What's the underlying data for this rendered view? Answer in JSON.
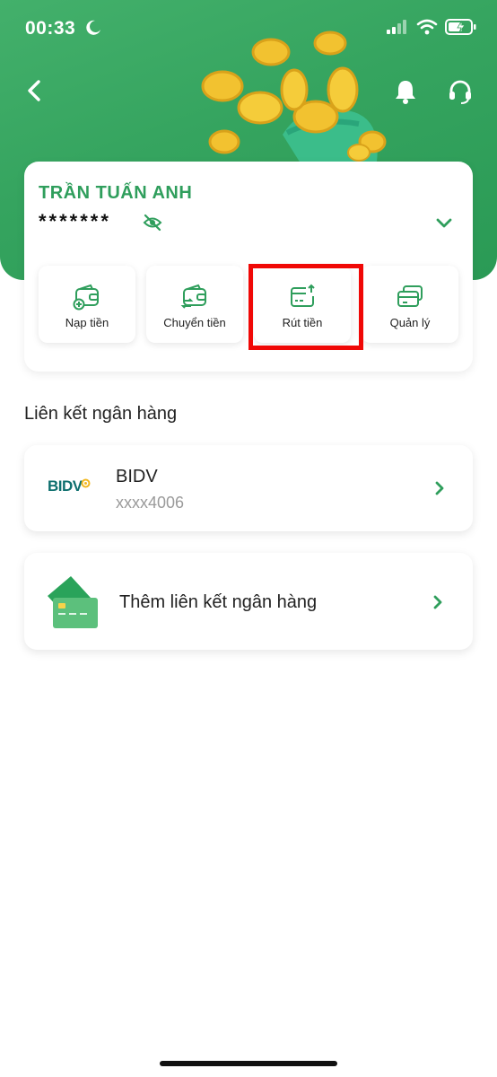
{
  "status_bar": {
    "time": "00:33"
  },
  "account": {
    "holder_name": "TRẦN TUẤN ANH",
    "balance_masked": "*******"
  },
  "actions": [
    {
      "label": "Nạp tiền",
      "icon": "wallet-add-icon"
    },
    {
      "label": "Chuyển tiền",
      "icon": "wallet-transfer-icon"
    },
    {
      "label": "Rút tiền",
      "icon": "card-withdraw-icon"
    },
    {
      "label": "Quản lý",
      "icon": "cards-manage-icon"
    }
  ],
  "linked_banks": {
    "section_title": "Liên kết ngân hàng",
    "banks": [
      {
        "logo_text": "BIDV",
        "name": "BIDV",
        "account": "xxxx4006"
      }
    ],
    "add_label": "Thêm liên kết ngân hàng"
  },
  "colors": {
    "brand_green": "#2f9e5c",
    "header_green": "#35a45f",
    "highlight_red": "#f00806"
  }
}
